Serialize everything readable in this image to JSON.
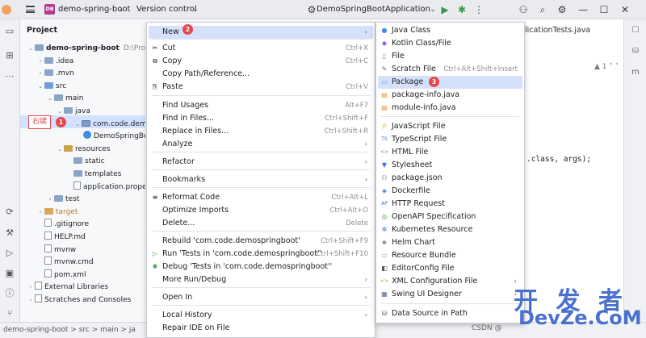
{
  "titlebar": {
    "project_badge": "DB",
    "project_name": "demo-spring-boot",
    "version_control": "Version control",
    "run_config": "DemoSpringBootApplication"
  },
  "project_panel": {
    "title": "Project",
    "tree": [
      {
        "label": "demo-spring-boot",
        "suffix": "D:\\Proje",
        "indent": 0,
        "icon": "folder-icon"
      },
      {
        "label": ".idea",
        "indent": 1,
        "icon": "folder-icon"
      },
      {
        "label": ".mvn",
        "indent": 1,
        "icon": "folder-icon"
      },
      {
        "label": "src",
        "indent": 1,
        "icon": "folder-icon"
      },
      {
        "label": "main",
        "indent": 2,
        "icon": "folder-icon"
      },
      {
        "label": "java",
        "indent": 3,
        "icon": "folder-icon"
      },
      {
        "label": "com.code.demosp",
        "indent": 4,
        "icon": "package-icon"
      },
      {
        "label": "DemoSpringBo",
        "indent": 5,
        "icon": "java-class-icon"
      },
      {
        "label": "resources",
        "indent": 3,
        "icon": "folder-icon"
      },
      {
        "label": "static",
        "indent": 4,
        "icon": "folder-icon"
      },
      {
        "label": "templates",
        "indent": 4,
        "icon": "folder-icon"
      },
      {
        "label": "application.prope",
        "indent": 4,
        "icon": "file-icon"
      },
      {
        "label": "test",
        "indent": 2,
        "icon": "folder-icon"
      },
      {
        "label": "target",
        "indent": 1,
        "icon": "folder-icon"
      },
      {
        "label": ".gitignore",
        "indent": 1,
        "icon": "file-icon"
      },
      {
        "label": "HELP.md",
        "indent": 1,
        "icon": "file-icon"
      },
      {
        "label": "mvnw",
        "indent": 1,
        "icon": "file-icon"
      },
      {
        "label": "mvnw.cmd",
        "indent": 1,
        "icon": "file-icon"
      },
      {
        "label": "pom.xml",
        "indent": 1,
        "icon": "file-icon"
      },
      {
        "label": "External Libraries",
        "indent": 0,
        "icon": "library-icon"
      },
      {
        "label": "Scratches and Consoles",
        "indent": 0,
        "icon": "scratch-icon"
      }
    ]
  },
  "annotations": {
    "right_click": "右键",
    "step1": "1",
    "step2": "2",
    "step3": "3"
  },
  "editor": {
    "tab": "plicationTests.java",
    "code": ".class, args);",
    "warn": "▲ 1  ˄  ˅"
  },
  "context_menu": [
    {
      "label": "New",
      "shortcut": "",
      "submenu": true,
      "highlight": true
    },
    {
      "label": "Cut",
      "shortcut": "Ctrl+X"
    },
    {
      "label": "Copy",
      "shortcut": "Ctrl+C"
    },
    {
      "label": "Copy Path/Reference...",
      "shortcut": ""
    },
    {
      "label": "Paste",
      "shortcut": "Ctrl+V"
    },
    {
      "label": "Find Usages",
      "shortcut": "Alt+F7"
    },
    {
      "label": "Find in Files...",
      "shortcut": "Ctrl+Shift+F"
    },
    {
      "label": "Replace in Files...",
      "shortcut": "Ctrl+Shift+R"
    },
    {
      "label": "Analyze",
      "shortcut": "",
      "submenu": true
    },
    {
      "label": "Refactor",
      "shortcut": "",
      "submenu": true
    },
    {
      "label": "Bookmarks",
      "shortcut": "",
      "submenu": true
    },
    {
      "label": "Reformat Code",
      "shortcut": "Ctrl+Alt+L"
    },
    {
      "label": "Optimize Imports",
      "shortcut": "Ctrl+Alt+O"
    },
    {
      "label": "Delete...",
      "shortcut": "Delete"
    },
    {
      "label": "Rebuild 'com.code.demospringboot'",
      "shortcut": "Ctrl+Shift+F9"
    },
    {
      "label": "Run 'Tests in 'com.code.demospringboot''",
      "shortcut": "Ctrl+Shift+F10"
    },
    {
      "label": "Debug 'Tests in 'com.code.demospringboot''",
      "shortcut": ""
    },
    {
      "label": "More Run/Debug",
      "shortcut": "",
      "submenu": true
    },
    {
      "label": "Open In",
      "shortcut": "",
      "submenu": true
    },
    {
      "label": "Local History",
      "shortcut": "",
      "submenu": true
    },
    {
      "label": "Repair IDE on File",
      "shortcut": ""
    }
  ],
  "new_submenu": [
    {
      "label": "Java Class",
      "icon": "java-class-icon",
      "color": "#3c8de0"
    },
    {
      "label": "Kotlin Class/File",
      "icon": "kotlin-icon",
      "color": "#8a5cf0"
    },
    {
      "label": "File",
      "icon": "file-icon",
      "color": "#888888"
    },
    {
      "label": "Scratch File",
      "shortcut": "Ctrl+Alt+Shift+Insert",
      "icon": "scratch-icon",
      "color": "#5a6b8c"
    },
    {
      "label": "Package",
      "icon": "package-icon",
      "color": "#6d9ed6",
      "highlight": true
    },
    {
      "label": "package-info.java",
      "icon": "java-file-icon",
      "color": "#e0913a"
    },
    {
      "label": "module-info.java",
      "icon": "java-file-icon",
      "color": "#e0913a"
    },
    {
      "label": "JavaScript File",
      "icon": "js-icon",
      "color": "#d8b41c"
    },
    {
      "label": "TypeScript File",
      "icon": "ts-icon",
      "color": "#3178c6"
    },
    {
      "label": "HTML File",
      "icon": "html-icon",
      "color": "#5a9a3a"
    },
    {
      "label": "Stylesheet",
      "icon": "css-icon",
      "color": "#3c6fd8"
    },
    {
      "label": "package.json",
      "icon": "json-icon",
      "color": "#4a8c3a"
    },
    {
      "label": "Dockerfile",
      "icon": "docker-icon",
      "color": "#2f7bd8"
    },
    {
      "label": "HTTP Request",
      "icon": "api-icon",
      "color": "#3c6fd8"
    },
    {
      "label": "OpenAPI Specification",
      "icon": "openapi-icon",
      "color": "#5aa03a"
    },
    {
      "label": "Kubernetes Resource",
      "icon": "kubernetes-icon",
      "color": "#326ce5"
    },
    {
      "label": "Helm Chart",
      "icon": "helm-icon",
      "color": "#3a4a6c"
    },
    {
      "label": "Resource Bundle",
      "icon": "bundle-icon",
      "color": "#6d9ed6"
    },
    {
      "label": "EditorConfig File",
      "icon": "editorconfig-icon",
      "color": "#555555"
    },
    {
      "label": "XML Configuration File",
      "icon": "xml-icon",
      "color": "#d08a2a",
      "submenu": true
    },
    {
      "label": "Swing UI Designer",
      "icon": "swing-icon",
      "color": "#5a6b8c",
      "submenu": true
    },
    {
      "label": "Data Source in Path",
      "icon": "database-icon",
      "color": "#555555"
    }
  ],
  "statusbar": {
    "breadcrumb": "demo-spring-boot  >  src  >  main  >  ja"
  },
  "watermark": {
    "line1": "开 发 者",
    "line2": "DevZe.CoM",
    "csdn": "CSDN @"
  }
}
